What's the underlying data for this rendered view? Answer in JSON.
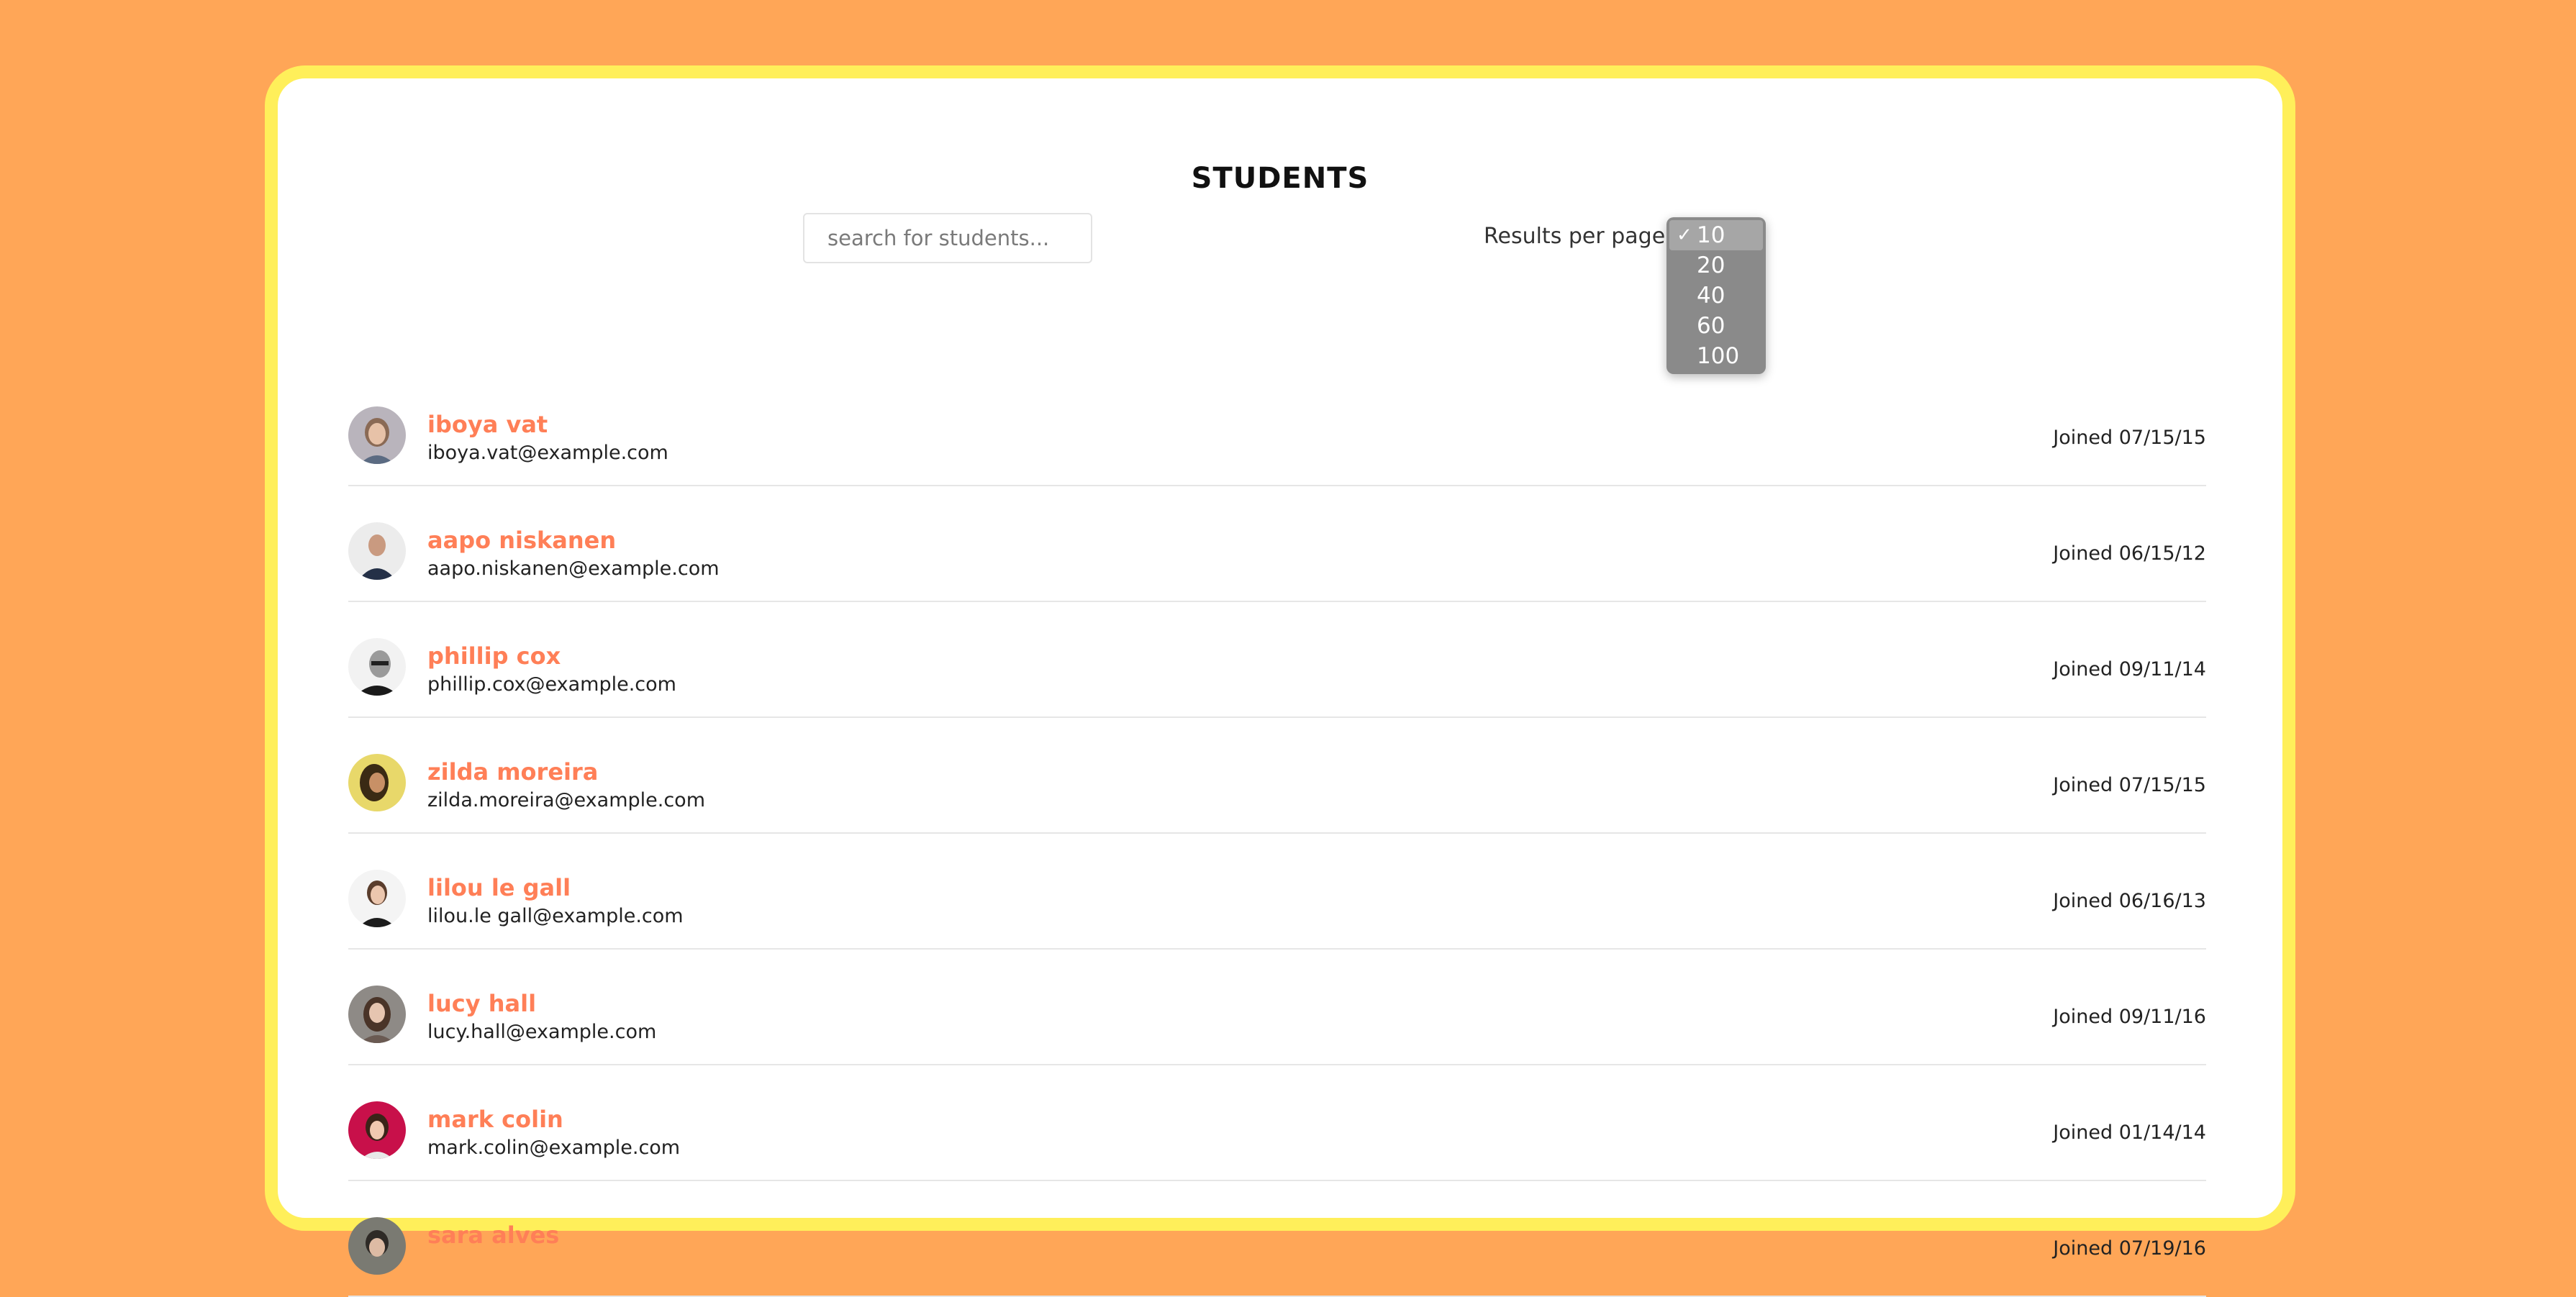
{
  "page": {
    "title": "STUDENTS",
    "background_color": "#FFA657",
    "card_border_color": "#FFEF5A",
    "accent_color": "#FF7F57"
  },
  "search": {
    "placeholder": "search for students..."
  },
  "results_per_page": {
    "label": "Results per page",
    "selected": "10",
    "options": [
      {
        "label": "10",
        "selected": true
      },
      {
        "label": "20",
        "selected": false
      },
      {
        "label": "40",
        "selected": false
      },
      {
        "label": "60",
        "selected": false
      },
      {
        "label": "100",
        "selected": false
      }
    ]
  },
  "students": [
    {
      "name": "iboya vat",
      "email": "iboya.vat@example.com",
      "joined": "Joined 07/15/15",
      "avatar_icon": "avatar-photo"
    },
    {
      "name": "aapo niskanen",
      "email": "aapo.niskanen@example.com",
      "joined": "Joined 06/15/12",
      "avatar_icon": "avatar-photo"
    },
    {
      "name": "phillip cox",
      "email": "phillip.cox@example.com",
      "joined": "Joined 09/11/14",
      "avatar_icon": "avatar-photo"
    },
    {
      "name": "zilda moreira",
      "email": "zilda.moreira@example.com",
      "joined": "Joined 07/15/15",
      "avatar_icon": "avatar-photo"
    },
    {
      "name": "lilou le gall",
      "email": "lilou.le gall@example.com",
      "joined": "Joined 06/16/13",
      "avatar_icon": "avatar-photo"
    },
    {
      "name": "lucy hall",
      "email": "lucy.hall@example.com",
      "joined": "Joined 09/11/16",
      "avatar_icon": "avatar-photo"
    },
    {
      "name": "mark colin",
      "email": "mark.colin@example.com",
      "joined": "Joined 01/14/14",
      "avatar_icon": "avatar-photo"
    },
    {
      "name": "sara alves",
      "email": "",
      "joined": "Joined 07/19/16",
      "avatar_icon": "avatar-photo"
    }
  ]
}
